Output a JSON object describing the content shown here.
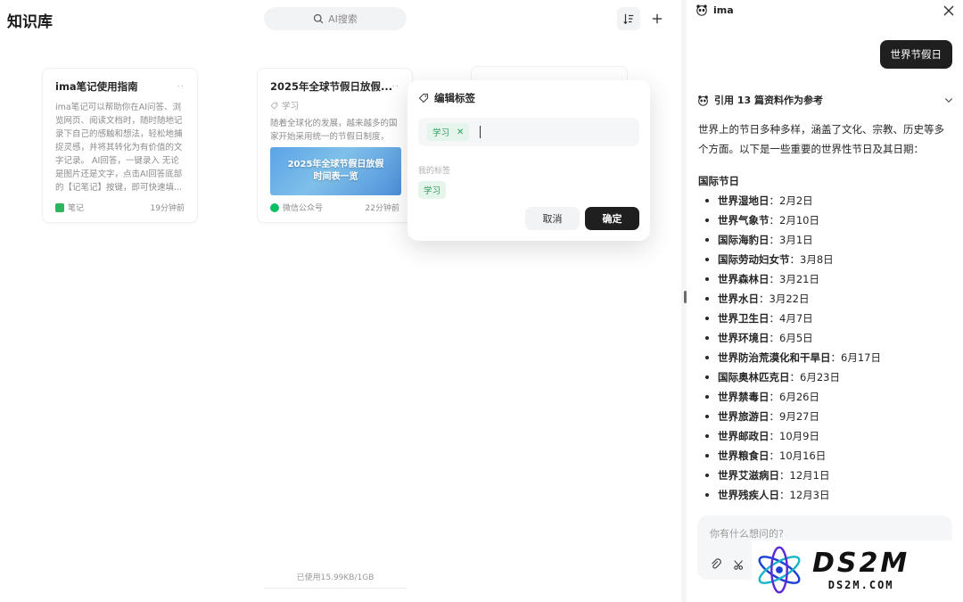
{
  "knowledge_base": {
    "title": "知识库",
    "search_label": "AI搜索",
    "cards": [
      {
        "title": "ima笔记使用指南",
        "body": "ima笔记可以帮助你在AI问答、浏览网页、阅读文档时，随时随地记录下自己的感触和想法，轻松地捕捉灵感，并将其转化为有价值的文字记录。 AI回答，一键录入 无论是图片还是文字，点击AI回答底部的【记笔记】按键，即可快速填...",
        "source": "笔记",
        "time": "19分钟前"
      },
      {
        "title": "2025年全球节假日放假...",
        "tag": "学习",
        "body": "随着全球化的发展，越来越多的国家开始采用统一的节假日制度，2...",
        "banner": "2025年全球节假日放假时间表一览",
        "source": "微信公众号",
        "time": "22分钟前"
      }
    ],
    "usage": "已使用15.99KB/1GB"
  },
  "modal": {
    "title": "编辑标签",
    "current_tag": "学习",
    "my_tags_label": "我的标签",
    "my_tags": [
      "学习"
    ],
    "cancel_label": "取消",
    "confirm_label": "确定"
  },
  "chat": {
    "app_name": "ima",
    "user_message": "世界节假日",
    "refs_label": "引用 13 篇资料作为参考",
    "intro": "世界上的节日多种多样，涵盖了文化、宗教、历史等多个方面。以下是一些重要的世界性节日及其日期：",
    "section_title": "国际节日",
    "holidays": [
      {
        "name": "世界湿地日",
        "date": "：2月2日"
      },
      {
        "name": "世界气象节",
        "date": "：2月10日"
      },
      {
        "name": "国际海豹日",
        "date": "：3月1日"
      },
      {
        "name": "国际劳动妇女节",
        "date": "：3月8日"
      },
      {
        "name": "世界森林日",
        "date": "：3月21日"
      },
      {
        "name": "世界水日",
        "date": "：3月22日"
      },
      {
        "name": "世界卫生日",
        "date": "：4月7日"
      },
      {
        "name": "世界环境日",
        "date": "：6月5日"
      },
      {
        "name": "世界防治荒漠化和干旱日",
        "date": "：6月17日"
      },
      {
        "name": "国际奥林匹克日",
        "date": "：6月23日"
      },
      {
        "name": "世界禁毒日",
        "date": "：6月26日"
      },
      {
        "name": "世界旅游日",
        "date": "：9月27日"
      },
      {
        "name": "世界邮政日",
        "date": "：10月9日"
      },
      {
        "name": "世界粮食日",
        "date": "：10月16日"
      },
      {
        "name": "世界艾滋病日",
        "date": "：12月1日"
      },
      {
        "name": "世界残疾人日",
        "date": "：12月3日"
      }
    ],
    "input_placeholder": "你有什么想问的?"
  },
  "watermark": {
    "big": "DS2M",
    "small": "DS2M.COM"
  },
  "colors": {
    "accent_dark": "#1f1f1f",
    "tag_green": "#2a9d5c",
    "tag_green_bg": "#e6f5ec"
  }
}
